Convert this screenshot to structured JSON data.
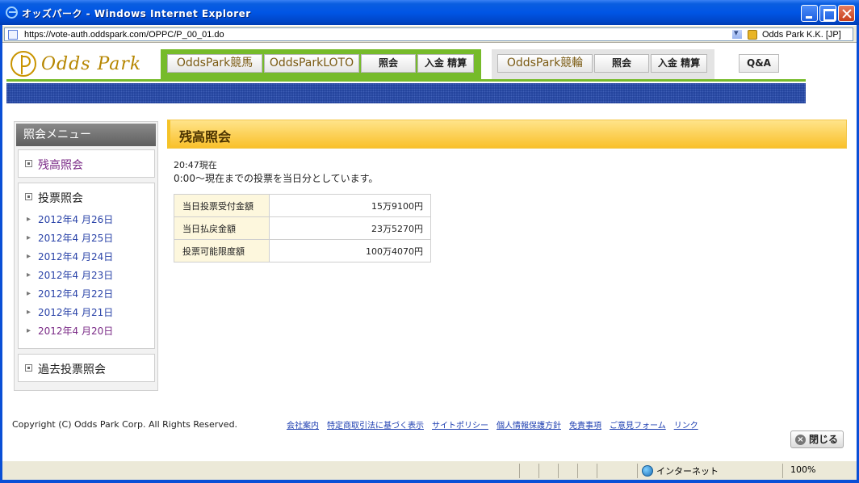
{
  "window": {
    "title": "オッズパーク - Windows Internet Explorer",
    "url": "https://vote-auth.oddspark.com/OPPC/P_00_01.do",
    "cert": "Odds Park K.K. [JP]"
  },
  "site": {
    "logo": "Odds Park",
    "nav_group1": [
      "OddsPark競馬",
      "OddsParkLOTO",
      "照会",
      "入金 精算"
    ],
    "nav_group2": [
      "OddsPark競輪",
      "照会",
      "入金 精算"
    ],
    "qa": "Q&A"
  },
  "sidebar": {
    "header": "照会メニュー",
    "balance": "残高照会",
    "votes": "投票照会",
    "dates": [
      "2012年4 月26日",
      "2012年4 月25日",
      "2012年4 月24日",
      "2012年4 月23日",
      "2012年4 月22日",
      "2012年4 月21日",
      "2012年4 月20日"
    ],
    "past": "過去投票照会"
  },
  "main": {
    "title": "残高照会",
    "time_note": "20:47現在",
    "period_note": "0:00～現在までの投票を当日分としています。",
    "rows": [
      {
        "label": "当日投票受付金額",
        "value": "15万9100円"
      },
      {
        "label": "当日払戻金額",
        "value": "23万5270円"
      },
      {
        "label": "投票可能限度額",
        "value": "100万4070円"
      }
    ]
  },
  "footer": {
    "copyright": "Copyright (C) Odds Park Corp. All Rights Reserved.",
    "links": [
      "会社案内",
      "特定商取引法に基づく表示",
      "サイトポリシー",
      "個人情報保護方針",
      "免責事項",
      "ご意見フォーム",
      "リンク"
    ],
    "close": "閉じる"
  },
  "status": {
    "zone": "インターネット",
    "zoom": "100%"
  },
  "colors": {
    "accent_green": "#76bb2a",
    "heading_yellow": "#f9c02a",
    "banner_blue": "#1f3f99"
  }
}
